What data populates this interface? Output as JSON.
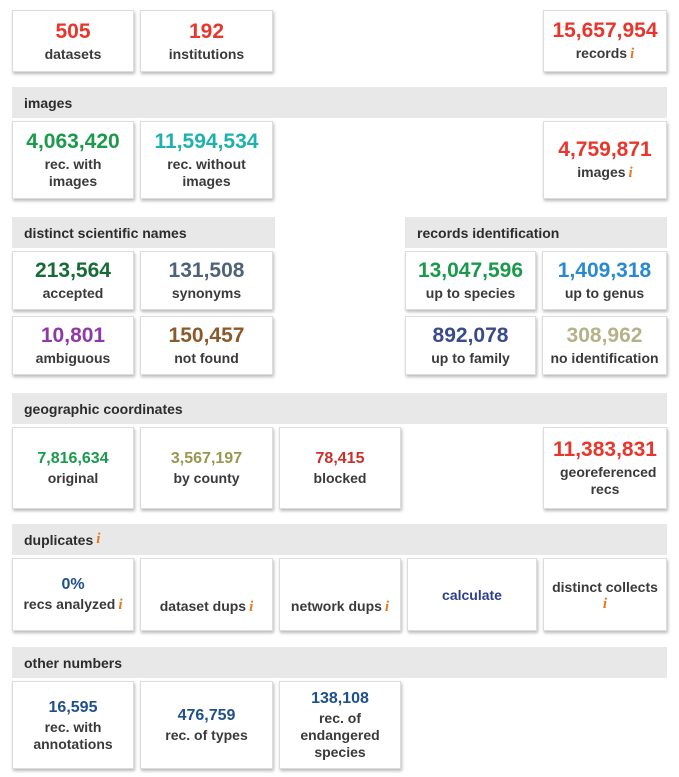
{
  "summary": {
    "datasets": {
      "value": "505",
      "label": "datasets"
    },
    "institutions": {
      "value": "192",
      "label": "institutions"
    },
    "records": {
      "value": "15,657,954",
      "label": "records",
      "info": "i"
    }
  },
  "images": {
    "header": "images",
    "with": {
      "value": "4,063,420",
      "label": "rec. with images"
    },
    "without": {
      "value": "11,594,534",
      "label": "rec. without images"
    },
    "total": {
      "value": "4,759,871",
      "label": "images",
      "info": "i"
    }
  },
  "names": {
    "header": "distinct scientific names",
    "accepted": {
      "value": "213,564",
      "label": "accepted"
    },
    "synonyms": {
      "value": "131,508",
      "label": "synonyms"
    },
    "ambiguous": {
      "value": "10,801",
      "label": "ambiguous"
    },
    "not_found": {
      "value": "150,457",
      "label": "not found"
    }
  },
  "identification": {
    "header": "records identification",
    "species": {
      "value": "13,047,596",
      "label": "up to species"
    },
    "genus": {
      "value": "1,409,318",
      "label": "up to genus"
    },
    "family": {
      "value": "892,078",
      "label": "up to family"
    },
    "none": {
      "value": "308,962",
      "label": "no identification"
    }
  },
  "geo": {
    "header": "geographic coordinates",
    "original": {
      "value": "7,816,634",
      "label": "original"
    },
    "county": {
      "value": "3,567,197",
      "label": "by county"
    },
    "blocked": {
      "value": "78,415",
      "label": "blocked"
    },
    "georef": {
      "value": "11,383,831",
      "label": "georeferenced recs"
    }
  },
  "duplicates": {
    "header": "duplicates",
    "info": "i",
    "analyzed": {
      "value": "0%",
      "label": "recs analyzed"
    },
    "dataset_dups": {
      "label": "dataset dups"
    },
    "network_dups": {
      "label": "network dups"
    },
    "calculate": {
      "label": "calculate"
    },
    "distinct": {
      "label": "distinct collects"
    }
  },
  "other": {
    "header": "other numbers",
    "annotations": {
      "value": "16,595",
      "label": "rec. with annotations"
    },
    "types": {
      "value": "476,759",
      "label": "rec. of types"
    },
    "endangered": {
      "value": "138,108",
      "label": "rec. of endangered species"
    }
  },
  "colors": {
    "red": "#e8362d",
    "green": "#1a9a4a",
    "teal": "#1fb0b0",
    "darkgreen": "#176b36",
    "slate": "#4d6478",
    "purple": "#8e3aa6",
    "brown": "#8a5a2b",
    "blue": "#2a8ad0",
    "navy": "#3a4a8a",
    "khaki": "#b5b28a",
    "olive": "#9a9650",
    "crimson": "#c9302c",
    "darkblue": "#1f4f8c",
    "orange": "#e8781e"
  }
}
